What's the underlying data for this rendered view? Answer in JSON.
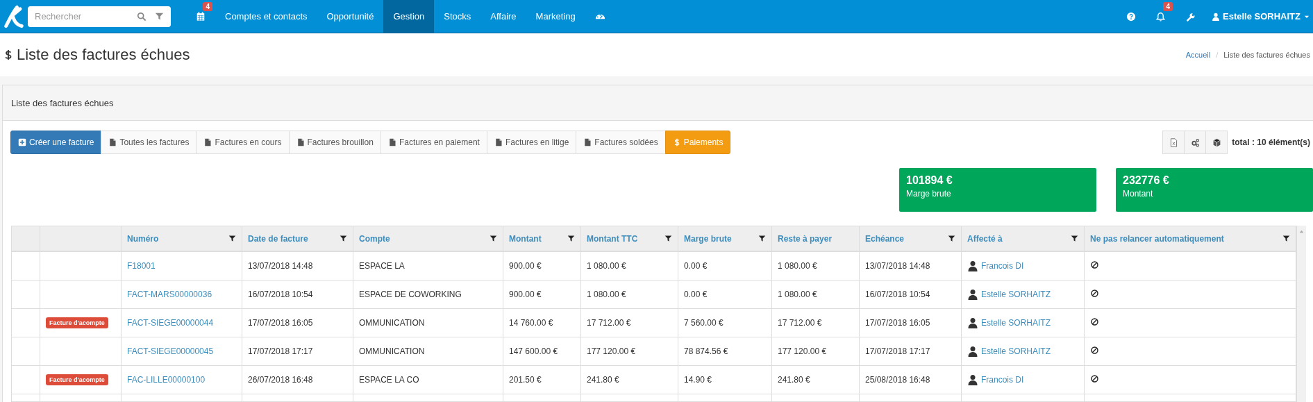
{
  "navbar": {
    "search": {
      "placeholder": "Rechercher"
    },
    "calendar_badge": "4",
    "menu": [
      {
        "label": "Comptes et contacts",
        "selected": false
      },
      {
        "label": "Opportunité",
        "selected": false
      },
      {
        "label": "Gestion",
        "selected": true
      },
      {
        "label": "Stocks",
        "selected": false
      },
      {
        "label": "Affaire",
        "selected": false
      },
      {
        "label": "Marketing",
        "selected": false
      }
    ],
    "notifications_badge": "4",
    "user": "Estelle SORHAITZ"
  },
  "page_title": "Liste des factures échues",
  "breadcrumb": [
    "Accueil",
    "Liste des factures échues"
  ],
  "breadcrumb_separator": "/",
  "panel": {
    "title": "Liste des factures échues",
    "toolbar": [
      {
        "label": "Créer une facture",
        "kind": "primary"
      },
      {
        "label": "Toutes les factures",
        "kind": "default"
      },
      {
        "label": "Factures en cours",
        "kind": "default"
      },
      {
        "label": "Factures brouillon",
        "kind": "default"
      },
      {
        "label": "Factures en paiement",
        "kind": "default"
      },
      {
        "label": "Factures en litige",
        "kind": "default"
      },
      {
        "label": "Factures soldées",
        "kind": "default"
      },
      {
        "label": "Paiements",
        "kind": "warning"
      }
    ],
    "total": "total : 10 élément(s)",
    "tiles": [
      {
        "value": "101894 €",
        "label": "Marge brute"
      },
      {
        "value": "232776 €",
        "label": "Montant"
      }
    ],
    "table": {
      "columns": [
        {
          "label": "Numéro",
          "filter": true
        },
        {
          "label": "Date de facture",
          "filter": true
        },
        {
          "label": "Compte",
          "filter": true
        },
        {
          "label": "Montant",
          "filter": true
        },
        {
          "label": "Montant TTC",
          "filter": true
        },
        {
          "label": "Marge brute",
          "filter": true
        },
        {
          "label": "Reste à payer",
          "filter": false
        },
        {
          "label": "Echéance",
          "filter": true
        },
        {
          "label": "Affecté à",
          "filter": true
        },
        {
          "label": "Ne pas relancer automatiquement",
          "filter": true
        }
      ],
      "rows": [
        {
          "numero": "F18001",
          "date": "13/07/2018 14:48",
          "compte": "ESPACE LA",
          "montant": "900.00 €",
          "ttc": "1 080.00 €",
          "marge": "0.00 €",
          "reste": "1 080.00 €",
          "echeance": "13/07/2018 14:48",
          "affecte": "Francois DI"
        },
        {
          "numero": "FACT-MARS00000036",
          "date": "16/07/2018 10:54",
          "compte": "ESPACE DE COWORKING",
          "montant": "900.00 €",
          "ttc": "1 080.00 €",
          "marge": "0.00 €",
          "reste": "1 080.00 €",
          "echeance": "16/07/2018 10:54",
          "affecte": "Estelle SORHAITZ"
        },
        {
          "badge": "Facture d'acompte",
          "numero": "FACT-SIEGE00000044",
          "date": "17/07/2018 16:05",
          "compte": "OMMUNICATION",
          "montant": "14 760.00 €",
          "ttc": "17 712.00 €",
          "marge": "7 560.00 €",
          "reste": "17 712.00 €",
          "echeance": "17/07/2018 16:05",
          "affecte": "Estelle SORHAITZ"
        },
        {
          "numero": "FACT-SIEGE00000045",
          "date": "17/07/2018 17:17",
          "compte": "OMMUNICATION",
          "montant": "147 600.00 €",
          "ttc": "177 120.00 €",
          "marge": "78 874.56 €",
          "reste": "177 120.00 €",
          "echeance": "17/07/2018 17:17",
          "affecte": "Estelle SORHAITZ"
        },
        {
          "badge": "Facture d'acompte",
          "numero": "FAC-LILLE00000100",
          "date": "26/07/2018 16:48",
          "compte": "ESPACE LA CO",
          "montant": "201.50 €",
          "ttc": "241.80 €",
          "marge": "14.90 €",
          "reste": "241.80 €",
          "echeance": "25/08/2018 16:48",
          "affecte": "Francois DI"
        }
      ]
    }
  }
}
